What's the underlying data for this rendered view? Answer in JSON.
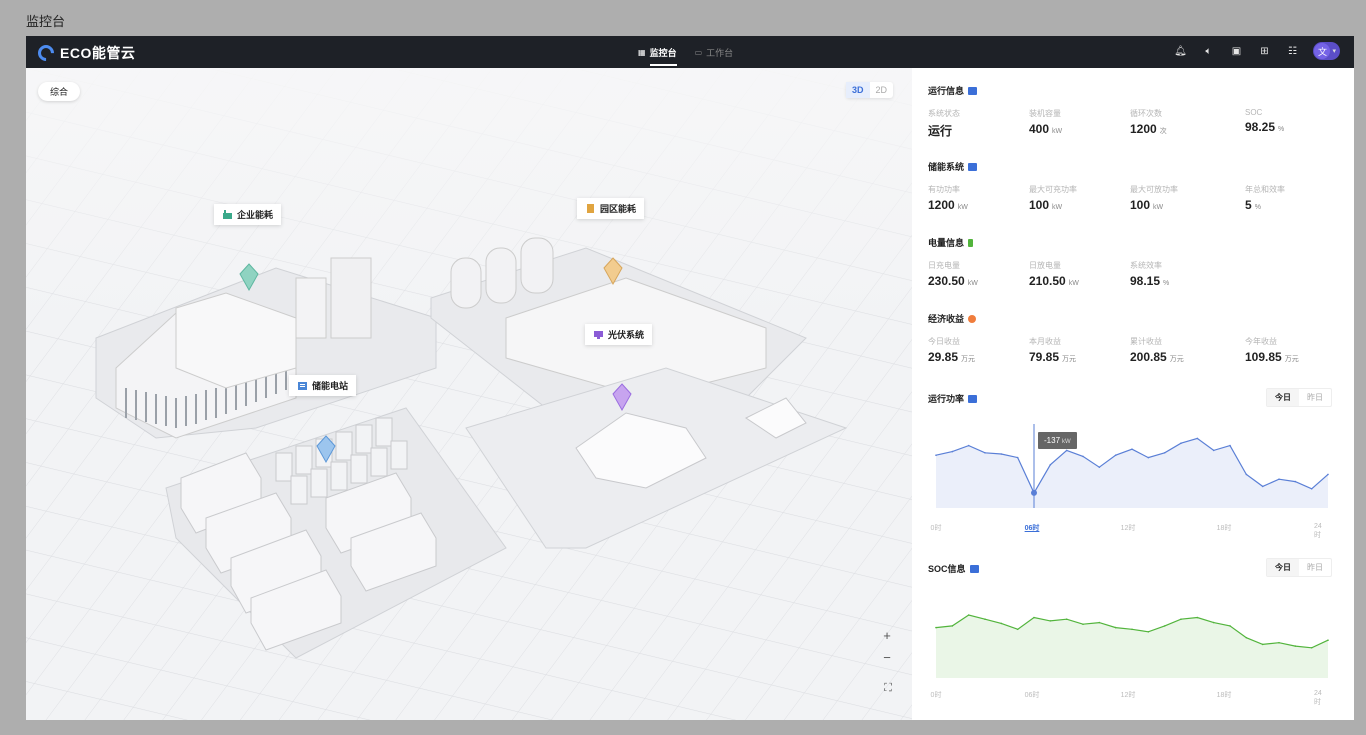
{
  "page_label": "监控台",
  "app": {
    "name": "ECO能管云"
  },
  "nav": [
    {
      "label": "监控台",
      "active": true
    },
    {
      "label": "工作台",
      "active": false
    }
  ],
  "user": {
    "avatar": "文"
  },
  "toolbar_icons": [
    "bell-icon",
    "speaker-icon",
    "document-icon",
    "language-icon",
    "layout-icon"
  ],
  "map": {
    "tag": "综合",
    "view_modes": [
      "3D",
      "2D"
    ],
    "active_view": "3D",
    "zoom_in": "+",
    "zoom_out": "−",
    "fullscreen": "⛶",
    "pois": {
      "enterprise": "企业能耗",
      "park": "园区能耗",
      "pv": "光伏系统",
      "storage": "储能电站"
    }
  },
  "run_info": {
    "title": "运行信息",
    "items": [
      {
        "label": "系统状态",
        "value": "运行",
        "unit": ""
      },
      {
        "label": "装机容量",
        "value": "400",
        "unit": "kW"
      },
      {
        "label": "循环次数",
        "value": "1200",
        "unit": "次"
      },
      {
        "label": "SOC",
        "value": "98.25",
        "unit": "%"
      }
    ]
  },
  "storage": {
    "title": "储能系统",
    "items": [
      {
        "label": "有功功率",
        "value": "1200",
        "unit": "kW"
      },
      {
        "label": "最大可充功率",
        "value": "100",
        "unit": "kW"
      },
      {
        "label": "最大可放功率",
        "value": "100",
        "unit": "kW"
      },
      {
        "label": "年总和效率",
        "value": "5",
        "unit": "%"
      }
    ]
  },
  "energy": {
    "title": "电量信息",
    "items": [
      {
        "label": "日充电量",
        "value": "230.50",
        "unit": "kW"
      },
      {
        "label": "日放电量",
        "value": "210.50",
        "unit": "kW"
      },
      {
        "label": "系统效率",
        "value": "98.15",
        "unit": "%"
      }
    ]
  },
  "economy": {
    "title": "经济收益",
    "items": [
      {
        "label": "今日收益",
        "value": "29.85",
        "unit": "万元"
      },
      {
        "label": "本月收益",
        "value": "79.85",
        "unit": "万元"
      },
      {
        "label": "累计收益",
        "value": "200.85",
        "unit": "万元"
      },
      {
        "label": "今年收益",
        "value": "109.85",
        "unit": "万元"
      }
    ]
  },
  "power_chart": {
    "title": "运行功率",
    "tabs": [
      "今日",
      "昨日"
    ],
    "active_tab": "今日",
    "tooltip": {
      "value": "-137",
      "unit": "kW"
    },
    "x_labels": [
      "0时",
      "06时",
      "12时",
      "18时",
      "24时"
    ],
    "highlight_label": "06时"
  },
  "soc_chart": {
    "title": "SOC信息",
    "tabs": [
      "今日",
      "昨日"
    ],
    "active_tab": "今日",
    "x_labels": [
      "0时",
      "06时",
      "12时",
      "18时",
      "24时"
    ]
  },
  "colors": {
    "accent": "#3b6fd8",
    "power_line": "#5a7fd6",
    "soc_line": "#52b43c",
    "topbar": "#1e2127"
  },
  "chart_data": [
    {
      "type": "area",
      "title": "运行功率",
      "xlabel": "",
      "ylabel": "",
      "x": [
        0,
        1,
        2,
        3,
        4,
        5,
        6,
        7,
        8,
        9,
        10,
        11,
        12,
        13,
        14,
        15,
        16,
        17,
        18,
        19,
        20,
        21,
        22,
        23,
        24
      ],
      "series": [
        {
          "values": [
            20,
            35,
            60,
            30,
            25,
            10,
            -137,
            -20,
            40,
            15,
            -30,
            20,
            45,
            10,
            30,
            70,
            90,
            40,
            60,
            -60,
            -110,
            -80,
            -90,
            -120,
            -60
          ]
        }
      ],
      "annotation": "-137 kW at 06时"
    },
    {
      "type": "area",
      "title": "SOC信息",
      "xlabel": "",
      "ylabel": "",
      "x": [
        0,
        1,
        2,
        3,
        4,
        5,
        6,
        7,
        8,
        9,
        10,
        11,
        12,
        13,
        14,
        15,
        16,
        17,
        18,
        19,
        20,
        21,
        22,
        23,
        24
      ],
      "series": [
        {
          "values": [
            60,
            62,
            75,
            70,
            65,
            58,
            72,
            68,
            70,
            64,
            66,
            60,
            58,
            55,
            62,
            70,
            72,
            66,
            62,
            48,
            40,
            42,
            38,
            36,
            45
          ]
        }
      ]
    }
  ]
}
